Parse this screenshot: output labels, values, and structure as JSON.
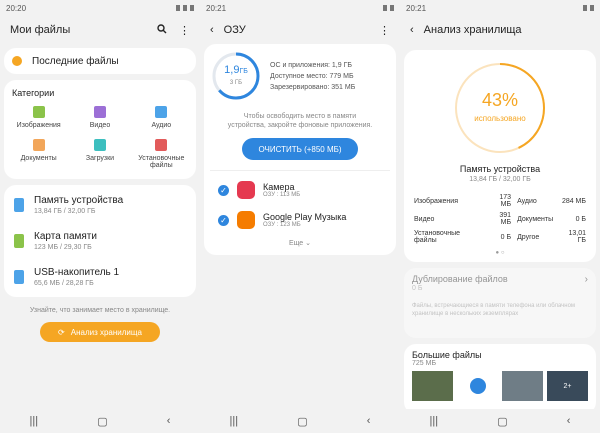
{
  "panel1": {
    "status_time": "20:20",
    "title": "Мои файлы",
    "recent_label": "Последние файлы",
    "categories_title": "Категории",
    "categories": [
      {
        "label": "Изображения",
        "icon": "image-icon",
        "color": "#8bc34a"
      },
      {
        "label": "Видео",
        "icon": "video-icon",
        "color": "#9c6fd6"
      },
      {
        "label": "Аудио",
        "icon": "audio-icon",
        "color": "#4da3e8"
      },
      {
        "label": "Документы",
        "icon": "document-icon",
        "color": "#f2a65a"
      },
      {
        "label": "Загрузки",
        "icon": "download-icon",
        "color": "#3dbfbf"
      },
      {
        "label": "Установочные файлы",
        "icon": "apk-icon",
        "color": "#e25b5b"
      }
    ],
    "storage": [
      {
        "title": "Память устройства",
        "subtitle": "13,84 ГБ / 32,00 ГБ",
        "icon": "phone-icon",
        "color": "#4da3e8"
      },
      {
        "title": "Карта памяти",
        "subtitle": "123 МБ / 29,30 ГБ",
        "icon": "sd-card-icon",
        "color": "#8bc34a"
      },
      {
        "title": "USB-накопитель 1",
        "subtitle": "65,6 МБ / 28,28 ГБ",
        "icon": "usb-icon",
        "color": "#4da3e8"
      }
    ],
    "hint": "Узнайте, что занимает место в хранилище.",
    "analyze_button": "Анализ хранилища"
  },
  "panel2": {
    "status_time": "20:21",
    "title": "ОЗУ",
    "ram_value": "1,9 ГБ",
    "ram_value_big": "1,9",
    "ram_unit": "ГБ",
    "ram_total": "3 ГБ",
    "lines": [
      "ОС и приложения: 1,9 ГБ",
      "Доступное место: 779 МБ",
      "Зарезервировано: 351 МБ"
    ],
    "hint": "Чтобы освободить место в памяти устройства, закройте фоновые приложения.",
    "clear_button": "ОЧИСТИТЬ (+850 МБ)",
    "apps": [
      {
        "name": "Камера",
        "ram": "ОЗУ : 113 МБ",
        "icon": "camera-app-icon",
        "color": "#e53950"
      },
      {
        "name": "Google Play Музыка",
        "ram": "ОЗУ : 123 МБ",
        "icon": "play-music-icon",
        "color": "#f57c00"
      }
    ],
    "more": "Еще"
  },
  "panel3": {
    "status_time": "20:21",
    "title": "Анализ хранилища",
    "percent": "43%",
    "percent_value": 43,
    "percent_label": "использовано",
    "device_title": "Память устройства",
    "device_sub": "13,84 ГБ / 32,00 ГБ",
    "stats": [
      [
        "Изображения",
        "173 МБ",
        "Аудио",
        "284 МБ"
      ],
      [
        "Видео",
        "391 МБ",
        "Документы",
        "0 Б"
      ],
      [
        "Установочные файлы",
        "0 Б",
        "Другое",
        "13,01 ГБ"
      ]
    ],
    "dup_title": "Дублирование файлов",
    "dup_count": "0 Б",
    "dup_desc": "Файлы, встречающиеся в памяти телефона или облачном хранилище в нескольких экземплярах",
    "large_title": "Большие файлы",
    "large_size": "725 МБ",
    "thumb_more": "2+"
  },
  "colors": {
    "accent_orange": "#f5a623",
    "accent_blue": "#2e86de"
  }
}
